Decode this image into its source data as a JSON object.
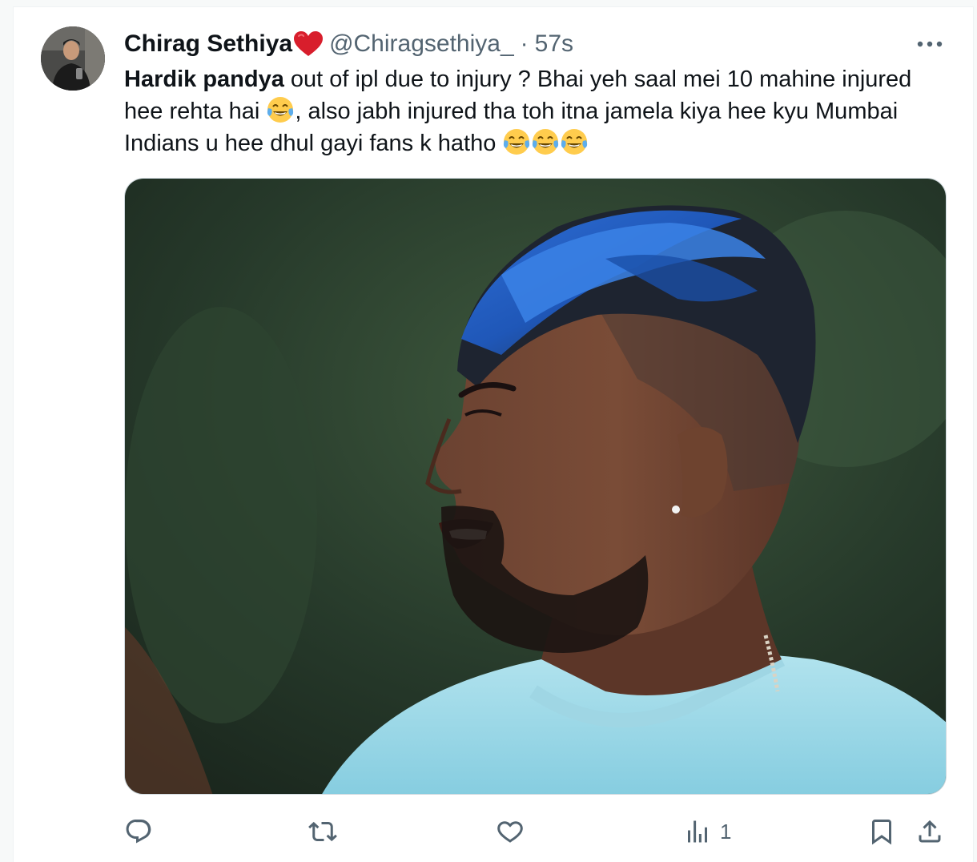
{
  "tweet": {
    "display_name": "Chirag Sethiya",
    "handle": "@Chiragsethiya_",
    "separator": "·",
    "time": "57s",
    "text": {
      "bold": "Hardik pandya",
      "part1": " out of ipl due to injury ? Bhai yeh saal mei 10 mahine injured hee rehta hai ",
      "part2": ", also jabh injured tha toh itna jamela kiya hee kyu Mumbai Indians u hee dhul gayi fans k hatho "
    },
    "emoji": "face-with-tears-of-joy",
    "media": {
      "icon": "photo"
    }
  },
  "actions": {
    "reply": {
      "icon": "reply-icon",
      "count": ""
    },
    "retweet": {
      "icon": "retweet-icon",
      "count": ""
    },
    "like": {
      "icon": "heart-icon",
      "count": ""
    },
    "views": {
      "icon": "analytics-icon",
      "count": "1"
    },
    "bookmark": {
      "icon": "bookmark-icon"
    },
    "share": {
      "icon": "share-icon"
    }
  },
  "colors": {
    "text": "#0f1419",
    "secondary": "#536471",
    "heart_emoji": "#d81e2c",
    "hair_blue": "#2f6fd6",
    "shirt": "#9ed8e6"
  }
}
